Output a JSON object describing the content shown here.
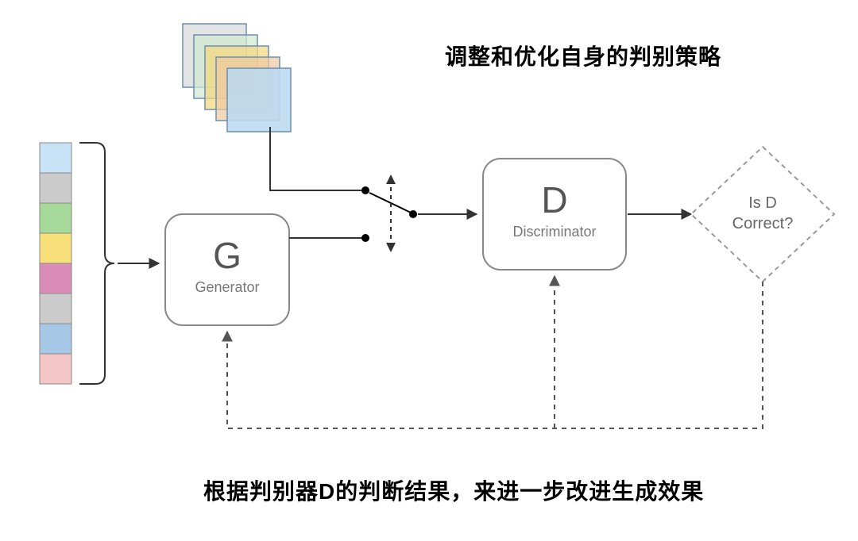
{
  "annotations": {
    "top": "调整和优化自身的判别策略",
    "bottom": "根据判别器D的判断结果，来进一步改进生成效果"
  },
  "boxes": {
    "generator": {
      "letter": "G",
      "label": "Generator"
    },
    "discriminator": {
      "letter": "D",
      "label": "Discriminator"
    }
  },
  "decision": {
    "line1": "Is D",
    "line2": "Correct?"
  },
  "input_vector_colors": [
    "#c9e3f6",
    "#cccccc",
    "#a7d99b",
    "#f7e07a",
    "#d98db8",
    "#cccccc",
    "#a7c7e7",
    "#f4c6c6"
  ],
  "image_stack_colors": [
    "#d9d9d9",
    "#d0e8d0",
    "#f5d77a",
    "#f0c8a0",
    "#bcd9ef"
  ]
}
